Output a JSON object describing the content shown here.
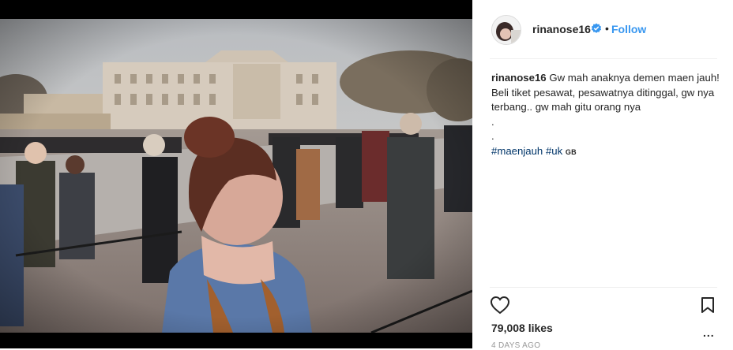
{
  "post": {
    "username": "rinanose16",
    "follow_label": "Follow",
    "separator": "•",
    "caption": {
      "username": "rinanose16",
      "text": "Gw mah anaknya demen maen jauh! Beli tiket pesawat, pesawatnya ditinggal, gw nya terbang.. gw mah gitu orang nya",
      "dot_line_1": ".",
      "dot_line_2": ".",
      "hashtag_1": "#maenjauh",
      "hashtag_2": "#uk",
      "location_code": "GB"
    },
    "likes": "79,008 likes",
    "timestamp": "4 DAYS AGO",
    "more_label": "..."
  },
  "icons": {
    "verified": "verified-badge-icon",
    "heart": "heart-icon",
    "bookmark": "bookmark-icon",
    "more": "more-options-icon"
  },
  "colors": {
    "link_blue": "#3897f0",
    "hashtag": "#003569",
    "verified": "#3897f0",
    "text": "#262626"
  }
}
